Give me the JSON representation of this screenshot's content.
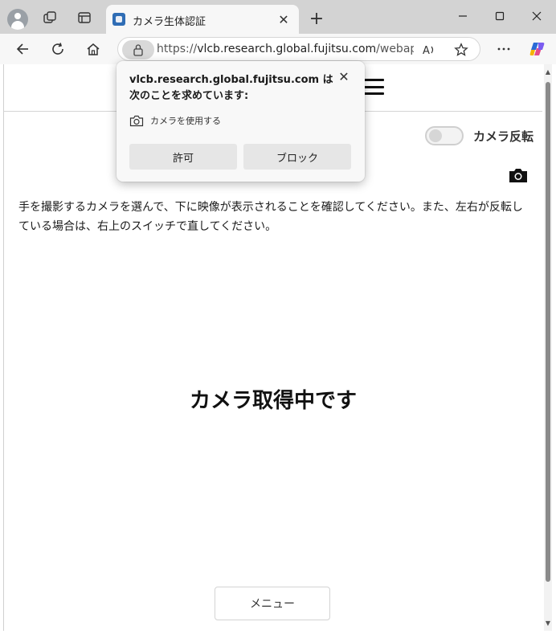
{
  "tab": {
    "title": "カメラ生体認証"
  },
  "address_bar": {
    "url_scheme": "https://",
    "url_host": "vlcb.research.global.fujitsu.com",
    "url_rest": "/webapp/..."
  },
  "popup": {
    "title": "vlcb.research.global.fujitsu.com は次のことを求めています:",
    "permission": "カメラを使用する",
    "allow_label": "許可",
    "block_label": "ブロック"
  },
  "page": {
    "toggle_label": "カメラ反転",
    "instructions": "手を撮影するカメラを選んで、下に映像が表示されることを確認してください。また、左右が反転している場合は、右上のスイッチで直してください。",
    "status": "カメラ取得中です",
    "menu_label": "メニュー"
  },
  "colors": {
    "tab_strip": "#d3d3d3",
    "toolbar": "#f7f7f7",
    "popup_bg": "#f8f8f8",
    "popup_button": "#e6e6e6"
  }
}
